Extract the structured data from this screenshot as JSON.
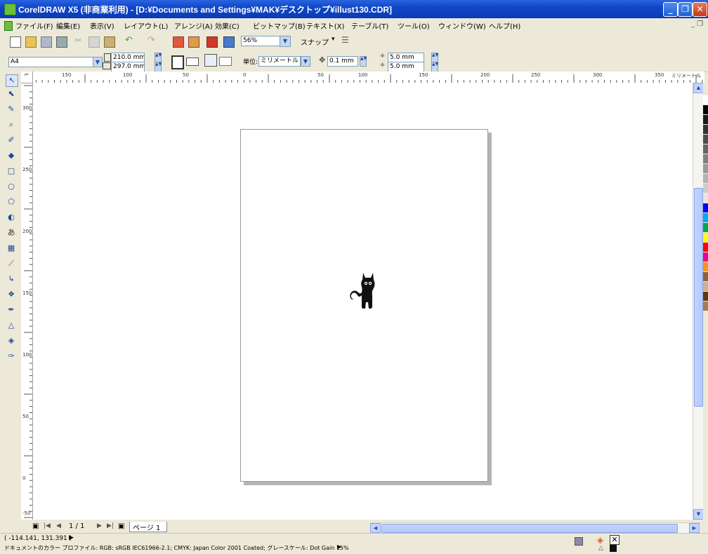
{
  "window": {
    "title": "CorelDRAW X5 (非商業利用) - [D:¥Documents and Settings¥MAK¥デスクトップ¥illust130.CDR]",
    "minimize": "_",
    "maximize": "❐",
    "close": "✕"
  },
  "menubar": {
    "items": [
      "ファイル(F)",
      "編集(E)",
      "表示(V)",
      "レイアウト(L)",
      "アレンジ(A)",
      "効果(C)",
      "ビットマップ(B)",
      "テキスト(X)",
      "テーブル(T)",
      "ツール(O)",
      "ウィンドウ(W)",
      "ヘルプ(H)"
    ]
  },
  "toolbar": {
    "zoom_value": "56%",
    "snap_label": "スナップ"
  },
  "property_bar": {
    "page_size": "A4",
    "width": "210.0 mm",
    "height": "297.0 mm",
    "units_label": "単位:",
    "units_value": "ミリメートル",
    "nudge": "0.1 mm",
    "dup_x": "5.0 mm",
    "dup_y": "5.0 mm"
  },
  "rulers": {
    "h_labels": [
      "150",
      "100",
      "50",
      "0",
      "50",
      "100",
      "150",
      "200",
      "250",
      "300",
      "350"
    ],
    "h_unit": "ミリメートル",
    "v_labels": [
      "300",
      "250",
      "200",
      "150",
      "100",
      "50",
      "0",
      "-50"
    ]
  },
  "page_nav": {
    "count": "1 / 1",
    "tab": "ページ 1"
  },
  "status": {
    "coords": "( -114.141, 131.391 )",
    "profile": "ドキュメントのカラー プロファイル: RGB: sRGB IEC61966-2.1; CMYK: Japan Color 2001 Coated; グレースケール: Dot Gain 15%"
  },
  "palette_colors": [
    "#ffffff",
    "#000000",
    "#1a1a1a",
    "#333333",
    "#4d4d4d",
    "#666666",
    "#808080",
    "#999999",
    "#b3b3b3",
    "#cccccc",
    "#e6e6e6",
    "#0000ff",
    "#00aaee",
    "#00a651",
    "#ffff00",
    "#ff0000",
    "#ec008c",
    "#f7941d",
    "#8c6239",
    "#c7b299",
    "#603913",
    "#a67c52"
  ]
}
